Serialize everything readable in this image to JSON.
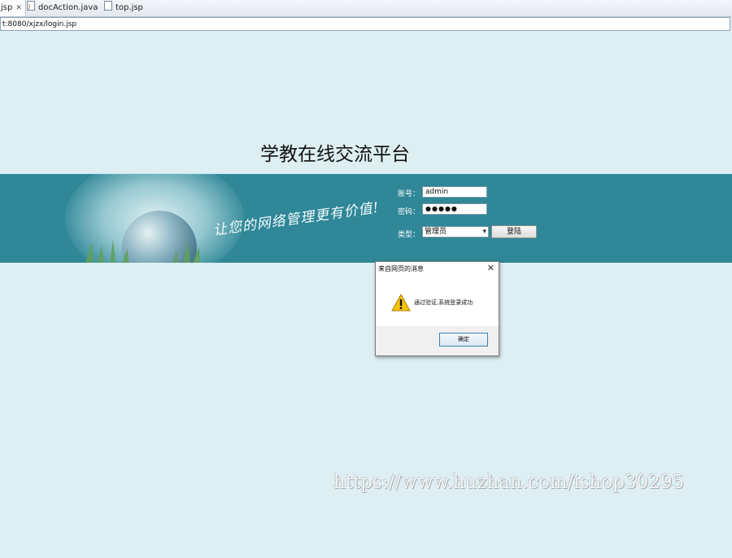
{
  "tabs": [
    {
      "label": "jsp",
      "close": "✕",
      "active": true
    },
    {
      "label": "docAction.java",
      "icon": "java-file-icon"
    },
    {
      "label": "top.jsp",
      "icon": "jsp-file-icon"
    }
  ],
  "address": {
    "url": "t:8080/xjzx/login.jsp"
  },
  "page": {
    "title": "学教在线交流平台",
    "slogan": "让您的网络管理更有价值!"
  },
  "login": {
    "account_label": "账号：",
    "account_value": "admin",
    "password_label": "密码：",
    "password_value": "●●●●●",
    "type_label": "类型：",
    "type_selected": "管理员",
    "submit_label": "登陆"
  },
  "dialog": {
    "title": "来自网页的消息",
    "close": "✕",
    "message": "通过验证,系统登录成功",
    "ok_label": "确定"
  },
  "watermark": "https://www.huzhan.com/ishop30295",
  "colors": {
    "banner": "#2f8797",
    "background": "#ddeff3",
    "warning": "#f4c20d"
  }
}
